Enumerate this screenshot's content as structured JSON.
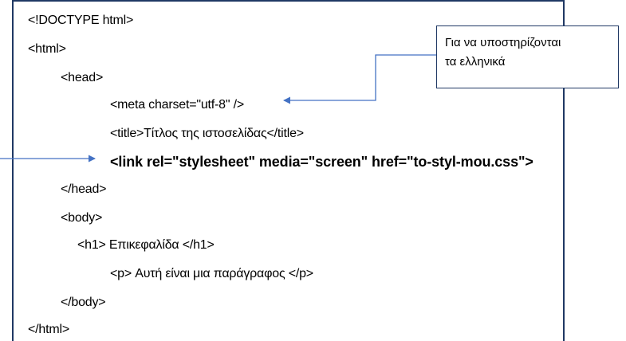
{
  "code_lines": [
    "<!DOCTYPE html>",
    "<html>",
    "<head>",
    "<meta charset=\"utf-8\" />",
    "<title>Τίτλος της ιστοσελίδας</title>",
    "<link rel=\"stylesheet\" media=\"screen\" href=\"to-styl-mou.css\">",
    "</head>",
    "<body>",
    "<h1> Επικεφαλίδα </h1>",
    "<p> Αυτή είναι μια παράγραφος </p>",
    "</body>",
    "</html>"
  ],
  "callout": {
    "line1": "Για να υποστηρίζονται",
    "line2": "τα ελληνικά"
  },
  "colors": {
    "frame_border": "#1f3864",
    "arrow": "#4472c4",
    "text": "#000000"
  }
}
